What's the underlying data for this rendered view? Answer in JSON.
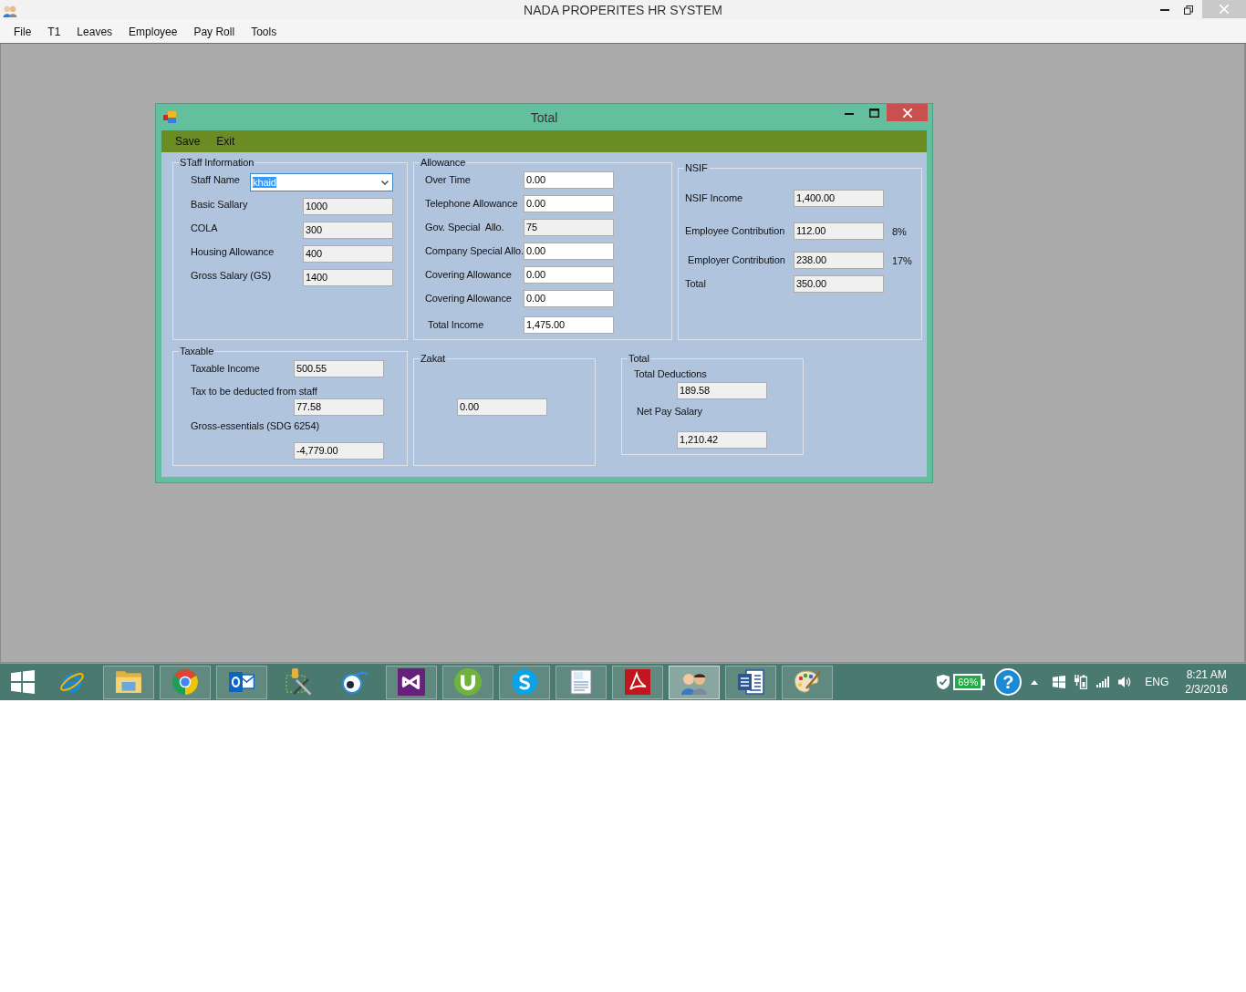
{
  "window": {
    "title": "NADA PROPERITES HR SYSTEM"
  },
  "menu": [
    "File",
    "T1",
    "Leaves",
    "Employee",
    "Pay Roll",
    "Tools"
  ],
  "dialog": {
    "title": "Total",
    "menu": [
      "Save",
      "Exit"
    ],
    "staff": {
      "legend": "STaff Information",
      "name_label": "Staff Name",
      "name_value": "khaid",
      "name_highlighted": true,
      "fields": [
        {
          "label": "Basic Sallary",
          "value": "1000",
          "readonly": true
        },
        {
          "label": "COLA",
          "value": "300",
          "readonly": true
        },
        {
          "label": "Housing Allowance",
          "value": "400",
          "readonly": true
        },
        {
          "label": "Gross Salary (GS)",
          "value": "1400",
          "readonly": true
        }
      ]
    },
    "allowance": {
      "legend": "Allowance",
      "fields": [
        {
          "label": "Over Time",
          "value": "0.00",
          "readonly": false
        },
        {
          "label": "Telephone Allowance",
          "value": "0.00",
          "readonly": false
        },
        {
          "label": "Gov. Special  Allo.",
          "value": "75",
          "readonly": true
        },
        {
          "label": "Company Special Allo.",
          "value": "0.00",
          "readonly": false
        },
        {
          "label": "Covering Allowance",
          "value": "0.00",
          "readonly": false
        },
        {
          "label": "Covering Allowance",
          "value": "0.00",
          "readonly": false
        },
        {
          "label": "Total Income",
          "value": "1,475.00",
          "readonly": false
        }
      ]
    },
    "nsif": {
      "legend": "NSIF",
      "fields": [
        {
          "label": "NSIF Income",
          "value": "1,400.00",
          "readonly": true
        },
        {
          "label": "Employee Contribution",
          "value": "112.00",
          "readonly": true,
          "rate": "8%"
        },
        {
          "label": "Employer Contribution",
          "value": "238.00",
          "readonly": true,
          "rate": "17%"
        },
        {
          "label": "Total",
          "value": "350.00",
          "readonly": true
        }
      ]
    },
    "taxable": {
      "legend": "Taxable",
      "fields": [
        {
          "kind": "inline",
          "label": "Taxable Income",
          "value": "500.55",
          "readonly": true
        },
        {
          "kind": "stacked",
          "label": "Tax to be deducted from staff",
          "value": "77.58",
          "readonly": true
        },
        {
          "kind": "stacked",
          "label": "Gross-essentials (SDG 6254)",
          "value": "-4,779.00",
          "readonly": true
        }
      ]
    },
    "zakat": {
      "legend": "Zakat",
      "value": "0.00",
      "readonly": true
    },
    "total": {
      "legend": "Total",
      "fields": [
        {
          "label": "Total Deductions",
          "value": "189.58",
          "readonly": true
        },
        {
          "label": "Net Pay Salary",
          "value": "1,210.42",
          "readonly": true
        }
      ]
    }
  },
  "taskbar": {
    "items": [
      {
        "kind": "globe",
        "running": false,
        "selected": false
      },
      {
        "kind": "folder",
        "running": true,
        "selected": false
      },
      {
        "kind": "ring",
        "running": true,
        "selected": false
      },
      {
        "kind": "mail",
        "running": true,
        "selected": false
      },
      {
        "kind": "tools",
        "running": false,
        "selected": false
      },
      {
        "kind": "eye",
        "running": false,
        "selected": false
      },
      {
        "kind": "loop",
        "running": true,
        "selected": false
      },
      {
        "kind": "torrent",
        "running": true,
        "selected": false
      },
      {
        "kind": "speech",
        "running": true,
        "selected": false
      },
      {
        "kind": "notepad",
        "running": true,
        "selected": false
      },
      {
        "kind": "reader",
        "running": true,
        "selected": false
      },
      {
        "kind": "people",
        "running": true,
        "selected": true
      },
      {
        "kind": "writer",
        "running": true,
        "selected": false
      },
      {
        "kind": "palette",
        "running": true,
        "selected": false
      }
    ],
    "tray": {
      "battery": "69%",
      "help": "?",
      "language": "ENG",
      "time": "8:21 AM",
      "date": "2/3/2016"
    }
  }
}
